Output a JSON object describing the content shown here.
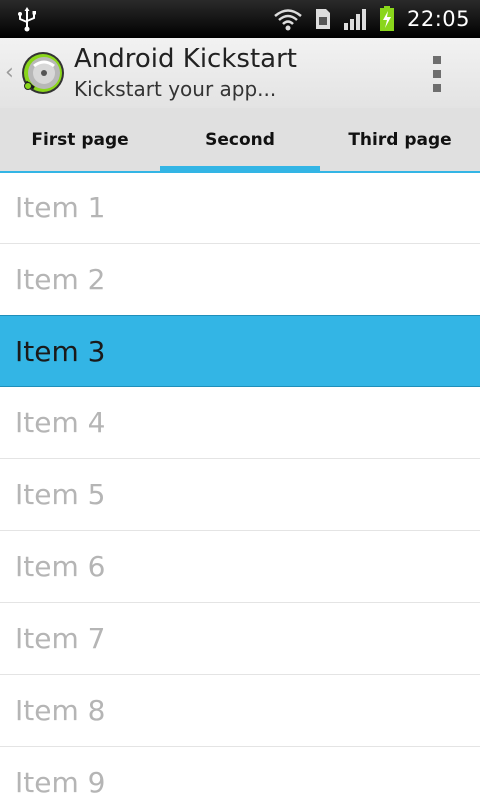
{
  "status_bar": {
    "time": "22:05",
    "icons": [
      "usb-icon",
      "wifi-icon",
      "sim-icon",
      "signal-icon",
      "battery-charging-icon"
    ],
    "battery_color": "#8ad61b"
  },
  "action_bar": {
    "title": "Android Kickstart",
    "subtitle": "Kickstart your app...",
    "icons": [
      "up-chevron-icon",
      "app-logo-icon",
      "overflow-menu-icon"
    ]
  },
  "tabs": [
    {
      "label": "First page",
      "selected": false
    },
    {
      "label": "Second",
      "selected": true
    },
    {
      "label": "Third page",
      "selected": false
    }
  ],
  "accent_color": "#33b5e5",
  "list": {
    "items": [
      "Item 1",
      "Item 2",
      "Item 3",
      "Item 4",
      "Item 5",
      "Item 6",
      "Item 7",
      "Item 8",
      "Item 9"
    ],
    "selected_index": 2
  }
}
